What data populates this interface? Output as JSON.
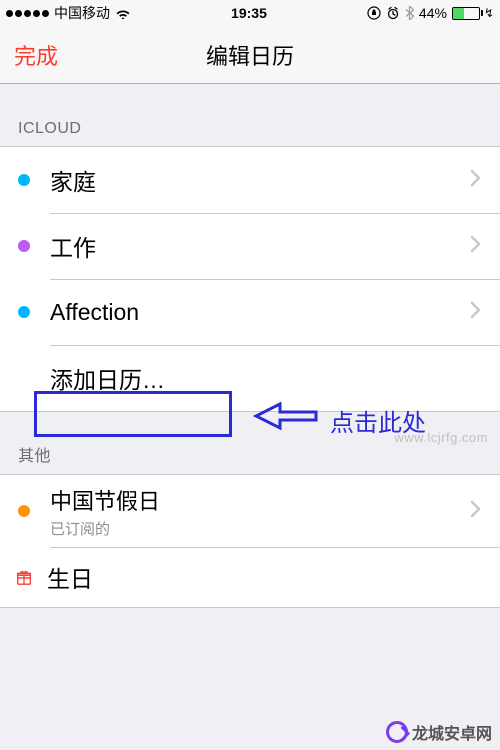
{
  "status": {
    "carrier": "中国移动",
    "time": "19:35",
    "battery_pct": "44%"
  },
  "nav": {
    "left": "完成",
    "title": "编辑日历"
  },
  "sections": {
    "icloud": {
      "header": "ICLOUD",
      "items": [
        {
          "label": "家庭",
          "color": "#00b7ff"
        },
        {
          "label": "工作",
          "color": "#bf5af2"
        },
        {
          "label": "Affection",
          "color": "#00b7ff"
        }
      ],
      "add_label": "添加日历…"
    },
    "other": {
      "header": "其他",
      "items": [
        {
          "label": "中国节假日",
          "sub": "已订阅的",
          "color": "#ff9500"
        },
        {
          "label": "生日",
          "icon": "gift"
        }
      ]
    }
  },
  "annotation": {
    "text": "点击此处"
  },
  "watermark": "www.lcjrfg.com",
  "brand": "龙城安卓网"
}
